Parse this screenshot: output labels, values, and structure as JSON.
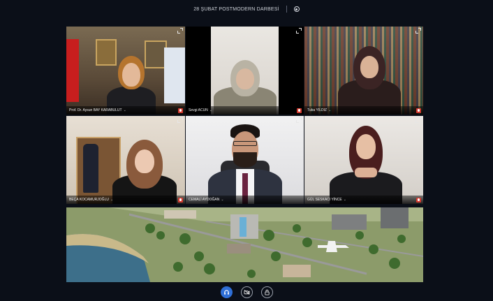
{
  "meeting": {
    "title": "28 ŞUBAT POSTMODERN DARBESİ"
  },
  "participants": [
    {
      "name": "Prof. Dr. Aysun BAY KARABULUT"
    },
    {
      "name": "Sevgi ACUN"
    },
    {
      "name": "Tuba YILDIZ"
    },
    {
      "name": "BEÇA KOCAMURJOĞLU"
    },
    {
      "name": "CEMALİ AYDOĞAN"
    },
    {
      "name": "GÜL SESKACI YİNCE"
    }
  ],
  "icons": {
    "recording": "record-icon",
    "expand": "expand-icon",
    "mic": "mic-muted-icon",
    "headset": "headset-icon",
    "camera": "camera-off-icon",
    "lock": "lock-icon"
  },
  "colors": {
    "accent": "#2f6fd6",
    "mic_muted": "#d23a2f",
    "background": "#0b0f18"
  }
}
